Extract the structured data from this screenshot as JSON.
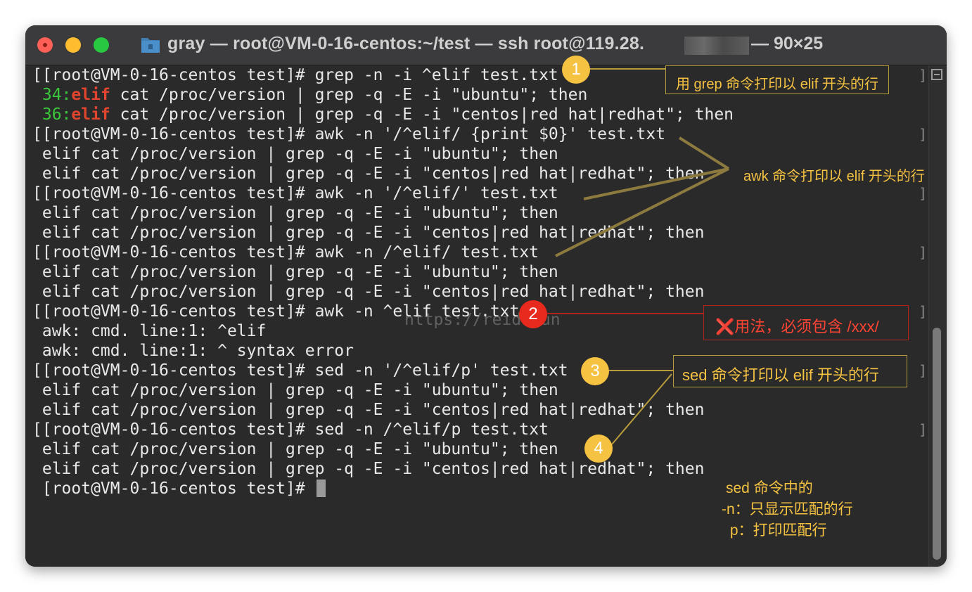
{
  "window": {
    "title": "gray — root@VM-0-16-centos:~/test — ssh root@119.28.",
    "title_tail": "— 90×25",
    "colors": {
      "close": "#fe5f57",
      "minimize": "#febc2e",
      "zoom": "#28c840"
    }
  },
  "terminal": {
    "lines": [
      {
        "prompt": "[[root@VM-0-16-centos test]# ",
        "cmd": "grep -n -i ^elif test.txt"
      },
      {
        "num": "34:",
        "match": "elif",
        "rest": " cat /proc/version | grep -q -E -i \"ubuntu\"; then"
      },
      {
        "num": "36:",
        "match": "elif",
        "rest": " cat /proc/version | grep -q -E -i \"centos|red hat|redhat\"; then"
      },
      {
        "prompt": "[[root@VM-0-16-centos test]# ",
        "cmd": "awk -n '/^elif/ {print $0}' test.txt"
      },
      {
        "text": " elif cat /proc/version | grep -q -E -i \"ubuntu\"; then"
      },
      {
        "text": " elif cat /proc/version | grep -q -E -i \"centos|red hat|redhat\"; then"
      },
      {
        "prompt": "[[root@VM-0-16-centos test]# ",
        "cmd": "awk -n '/^elif/' test.txt"
      },
      {
        "text": " elif cat /proc/version | grep -q -E -i \"ubuntu\"; then"
      },
      {
        "text": " elif cat /proc/version | grep -q -E -i \"centos|red hat|redhat\"; then"
      },
      {
        "prompt": "[[root@VM-0-16-centos test]# ",
        "cmd": "awk -n /^elif/ test.txt"
      },
      {
        "text": " elif cat /proc/version | grep -q -E -i \"ubuntu\"; then"
      },
      {
        "text": " elif cat /proc/version | grep -q -E -i \"centos|red hat|redhat\"; then"
      },
      {
        "prompt": "[[root@VM-0-16-centos test]# ",
        "cmd": "awk -n ^elif test.txt"
      },
      {
        "text": " awk: cmd. line:1: ^elif"
      },
      {
        "text": " awk: cmd. line:1: ^ syntax error"
      },
      {
        "prompt": "[[root@VM-0-16-centos test]# ",
        "cmd": "sed -n '/^elif/p' test.txt"
      },
      {
        "text": " elif cat /proc/version | grep -q -E -i \"ubuntu\"; then"
      },
      {
        "text": " elif cat /proc/version | grep -q -E -i \"centos|red hat|redhat\"; then"
      },
      {
        "prompt": "[[root@VM-0-16-centos test]# ",
        "cmd": "sed -n /^elif/p test.txt"
      },
      {
        "text": " elif cat /proc/version | grep -q -E -i \"ubuntu\"; then"
      },
      {
        "text": " elif cat /proc/version | grep -q -E -i \"centos|red hat|redhat\"; then"
      },
      {
        "prompt": " [root@VM-0-16-centos test]# ",
        "cmd": ""
      }
    ],
    "watermark": "https://reid.run"
  },
  "annotations": {
    "badge1": "1",
    "badge2": "2",
    "badge3": "3",
    "badge4": "4",
    "note1": "用 grep 命令打印以 elif 开头的行",
    "note_awk": "awk 命令打印以 elif 开头的行",
    "note2_mark": "❌",
    "note2": "用法，必须包含 /xxx/",
    "note3": "sed 命令打印以 elif 开头的行",
    "note4_line1": "sed 命令中的",
    "note4_line2": "-n：只显示匹配的行",
    "note4_line3": " p：打印匹配行",
    "colors": {
      "yellow": "#f5c242",
      "red": "#e8291d",
      "note_text_yellow": "#f5c242",
      "note_text_red": "#ff4433"
    }
  }
}
